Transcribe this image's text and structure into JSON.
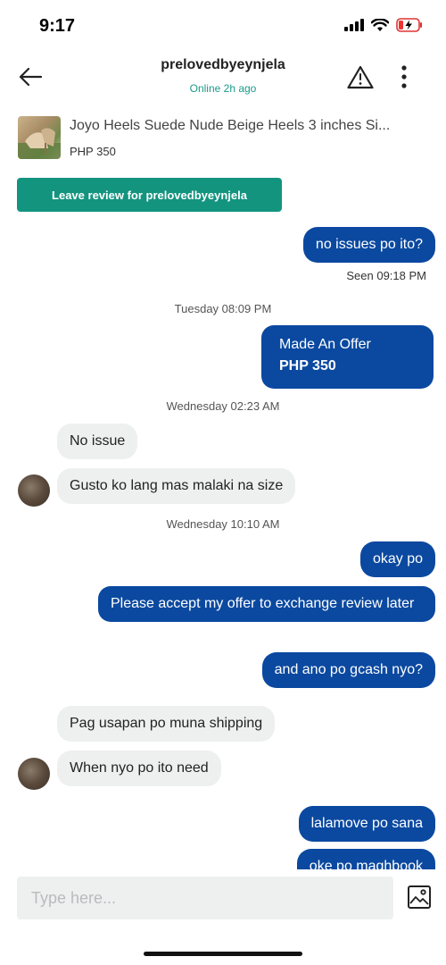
{
  "status_bar": {
    "time": "9:17"
  },
  "header": {
    "title": "prelovedbyeynjela",
    "status": "Online 2h ago",
    "back_icon": "arrow-left-icon",
    "report_icon": "warning-triangle-icon",
    "more_icon": "more-vertical-icon"
  },
  "listing": {
    "title": "Joyo Heels Suede Nude Beige Heels 3 inches Si...",
    "price": "PHP 350"
  },
  "review_button": {
    "label": "Leave review for prelovedbyeynjela"
  },
  "messages": {
    "m1": "no issues po ito?",
    "m1_seen": "Seen 09:18 PM",
    "sep1": "Tuesday 08:09 PM",
    "offer_title": "Made An Offer",
    "offer_price": "PHP 350",
    "sep2": "Wednesday 02:23 AM",
    "m2": "No issue",
    "m3": "Gusto ko lang mas malaki na size",
    "sep3": "Wednesday 10:10 AM",
    "m4": "okay po",
    "m5": "Please accept my offer to exchange review later",
    "m6": "and ano po gcash nyo?",
    "m7": "Pag usapan po muna shipping",
    "m8": "When nyo po ito need",
    "m9": "lalamove po sana",
    "m10": "oke po maghbook"
  },
  "composer": {
    "placeholder": "Type here..."
  },
  "colors": {
    "outgoing_bubble": "#0b49a0",
    "incoming_bubble": "#eef0f0",
    "accent_green": "#13947f",
    "online_status": "#1a9a8a"
  }
}
